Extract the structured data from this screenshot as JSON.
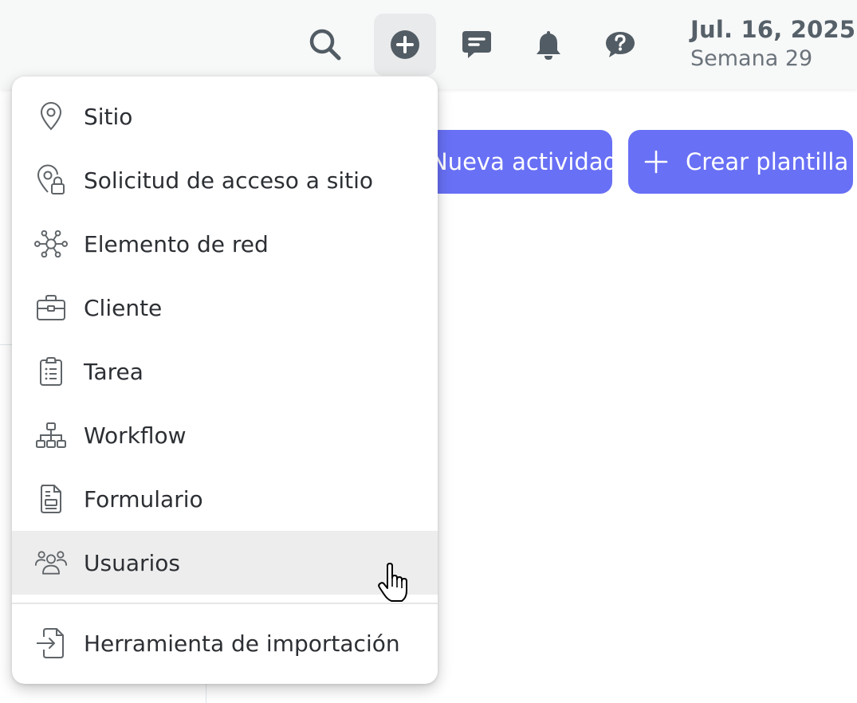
{
  "header": {
    "date": "Jul. 16, 2025",
    "week": "Semana 29",
    "icons": [
      "search-icon",
      "add-circle-icon",
      "chat-icon",
      "bell-icon",
      "help-icon"
    ]
  },
  "actions": {
    "new_activity_label": "Nueva actividad",
    "create_template_label": "Crear plantilla"
  },
  "create_menu": {
    "items": [
      {
        "label": "Sitio",
        "icon": "map-pin-icon"
      },
      {
        "label": "Solicitud de acceso a sitio",
        "icon": "map-pin-lock-icon"
      },
      {
        "label": "Elemento de red",
        "icon": "network-node-icon"
      },
      {
        "label": "Cliente",
        "icon": "briefcase-icon"
      },
      {
        "label": "Tarea",
        "icon": "clipboard-list-icon"
      },
      {
        "label": "Workflow",
        "icon": "hierarchy-icon"
      },
      {
        "label": "Formulario",
        "icon": "form-document-icon"
      },
      {
        "label": "Usuarios",
        "icon": "users-icon",
        "hovered": true
      }
    ],
    "import_label": "Herramienta de importación",
    "import_icon": "file-import-icon"
  },
  "colors": {
    "accent": "#6870f5",
    "icon_gray": "#525c64",
    "hover_bg": "#ededed"
  }
}
